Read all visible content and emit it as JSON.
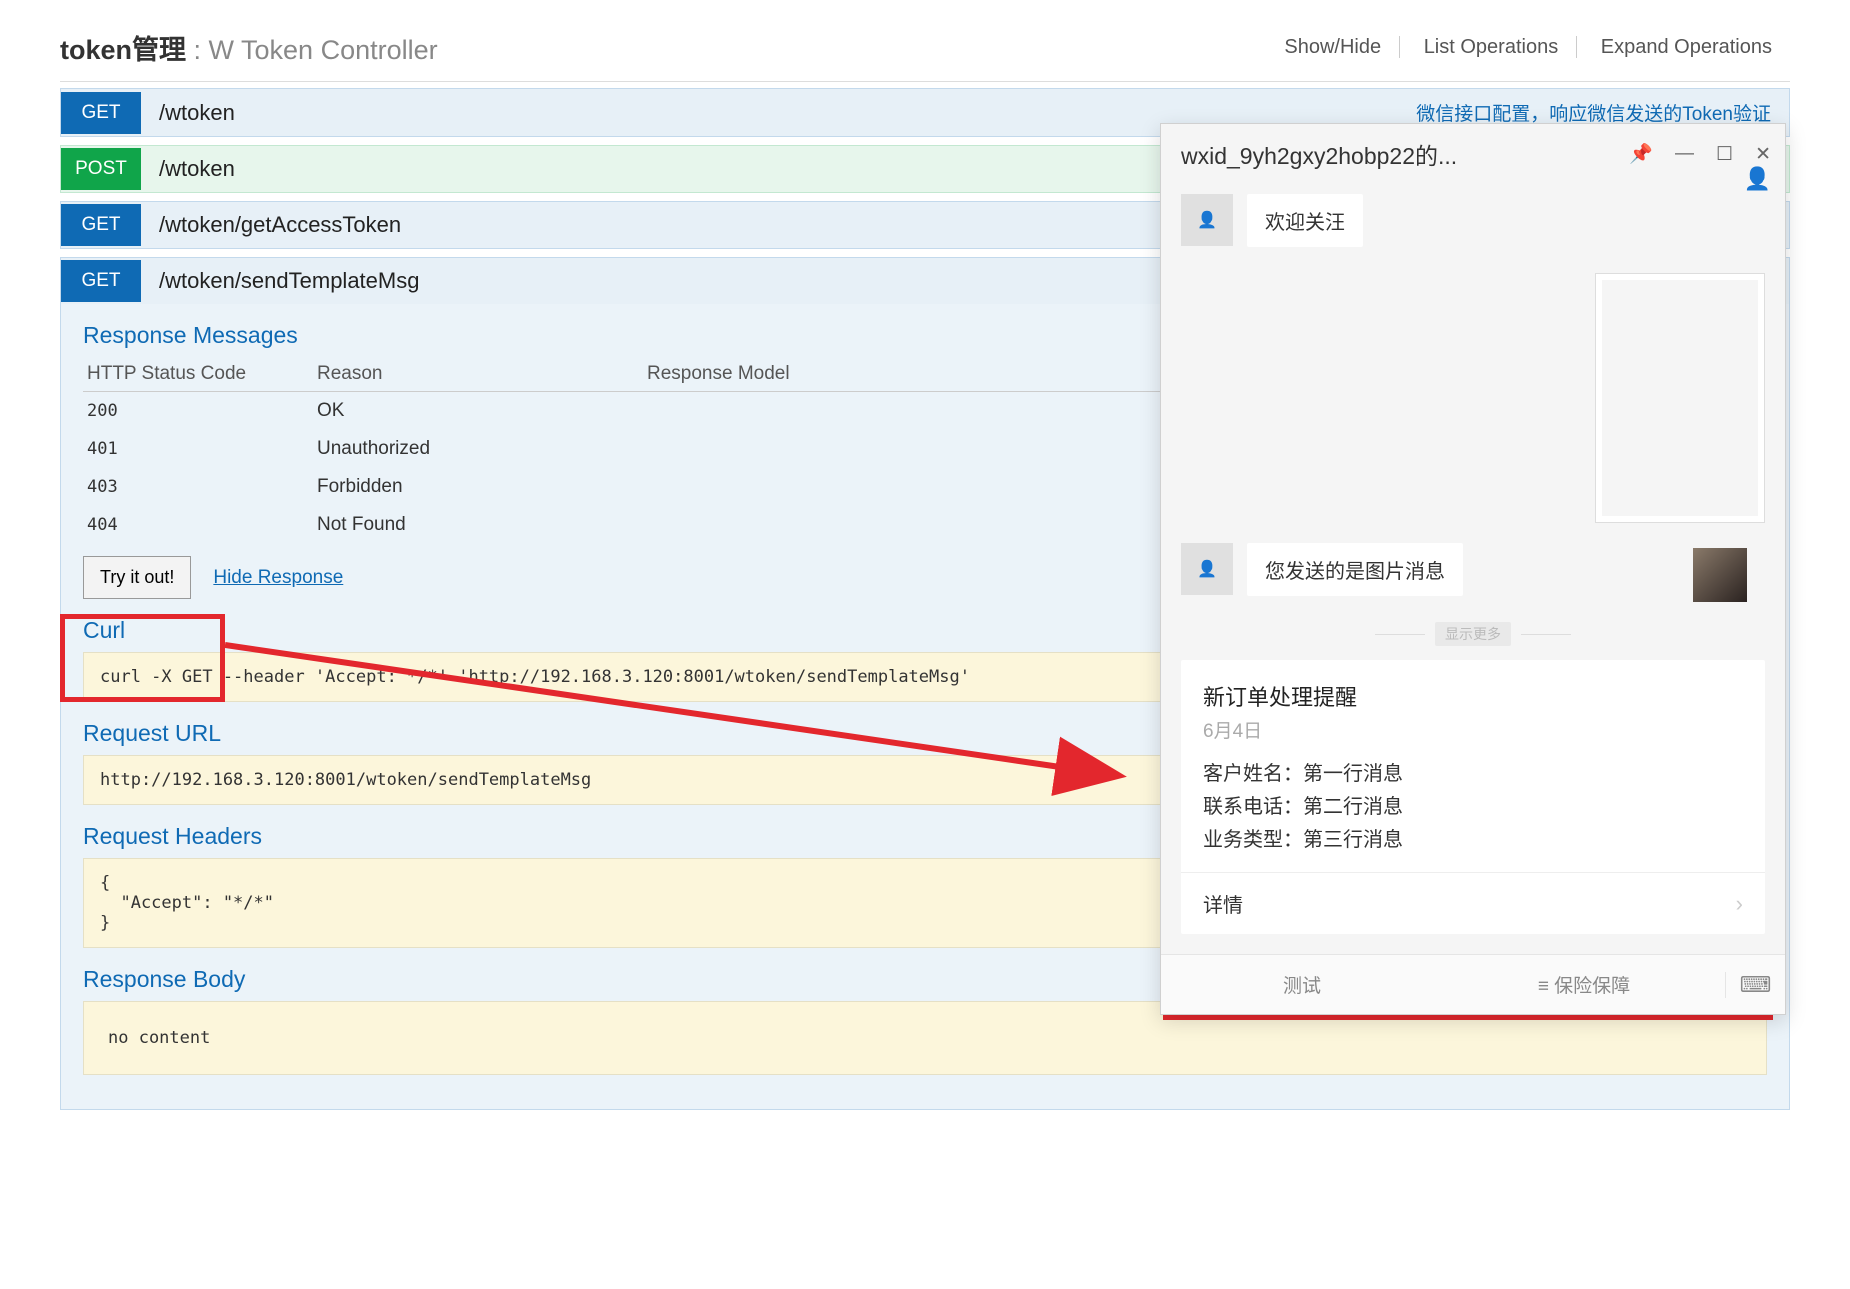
{
  "header": {
    "title_bold": "token管理",
    "title_sep": " : ",
    "controller": "W Token Controller",
    "actions": [
      "Show/Hide",
      "List Operations",
      "Expand Operations"
    ]
  },
  "operations": [
    {
      "method": "GET",
      "path": "/wtoken",
      "desc": "微信接口配置，响应微信发送的Token验证"
    },
    {
      "method": "POST",
      "path": "/wtoken"
    },
    {
      "method": "GET",
      "path": "/wtoken/getAccessToken"
    },
    {
      "method": "GET",
      "path": "/wtoken/sendTemplateMsg"
    }
  ],
  "response_messages": {
    "heading": "Response Messages",
    "columns": [
      "HTTP Status Code",
      "Reason",
      "Response Model"
    ],
    "rows": [
      {
        "code": "200",
        "reason": "OK"
      },
      {
        "code": "401",
        "reason": "Unauthorized"
      },
      {
        "code": "403",
        "reason": "Forbidden"
      },
      {
        "code": "404",
        "reason": "Not Found"
      }
    ]
  },
  "try_it": "Try it out!",
  "hide_response": "Hide Response",
  "curl": {
    "heading": "Curl",
    "text": "curl -X GET --header 'Accept: */*' 'http://192.168.3.120:8001/wtoken/sendTemplateMsg'"
  },
  "request_url": {
    "heading": "Request URL",
    "text": "http://192.168.3.120:8001/wtoken/sendTemplateMsg"
  },
  "request_headers": {
    "heading": "Request Headers",
    "text": "{\n  \"Accept\": \"*/*\"\n}"
  },
  "response_body": {
    "heading": "Response Body",
    "text": "no content"
  },
  "wechat": {
    "title": "wxid_9yh2gxy2hobp22的...",
    "msg1": "欢迎关汪",
    "msg2": "您发送的是图片消息",
    "divider": "显示更多",
    "card": {
      "title": "新订单处理提醒",
      "date": "6月4日",
      "rows": [
        "客户姓名：第一行消息",
        "联系电话：第二行消息",
        "业务类型：第三行消息"
      ],
      "footer": "详情"
    },
    "tabs": [
      "测试",
      "≡ 保险保障"
    ]
  }
}
